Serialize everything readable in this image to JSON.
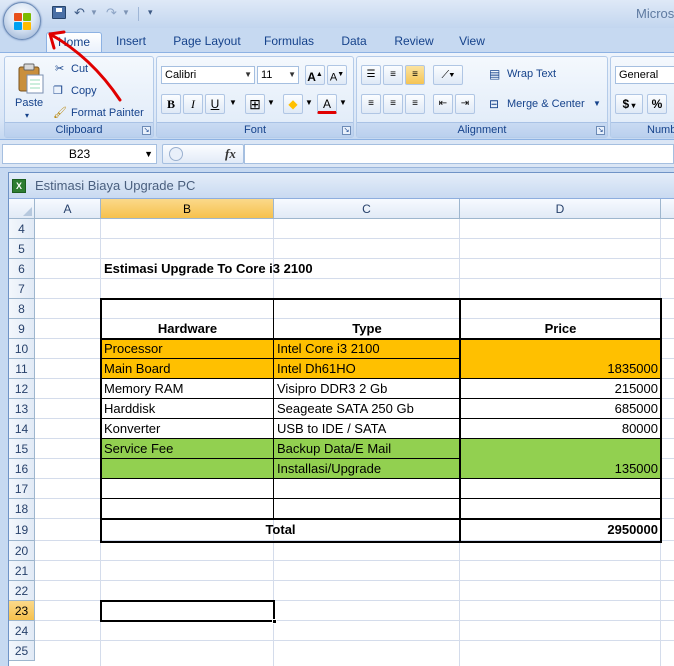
{
  "app": {
    "title": "Micros"
  },
  "tabs": [
    {
      "label": "Home",
      "active": true
    },
    {
      "label": "Insert"
    },
    {
      "label": "Page Layout"
    },
    {
      "label": "Formulas"
    },
    {
      "label": "Data"
    },
    {
      "label": "Review"
    },
    {
      "label": "View"
    }
  ],
  "ribbon": {
    "clipboard": {
      "label": "Clipboard",
      "paste": "Paste",
      "cut": "Cut",
      "copy": "Copy",
      "format_painter": "Format Painter"
    },
    "font": {
      "label": "Font",
      "name": "Calibri",
      "size": "11",
      "grow": "A",
      "shrink": "A",
      "bold": "B",
      "italic": "I",
      "underline": "U",
      "font_color": "A"
    },
    "alignment": {
      "label": "Alignment",
      "wrap_text": "Wrap Text",
      "merge_center": "Merge & Center"
    },
    "number": {
      "label": "Numb",
      "format": "General",
      "currency": "$",
      "percent": "%"
    }
  },
  "formula_bar": {
    "namebox": "B23",
    "fx": "fx",
    "formula": ""
  },
  "workbook": {
    "title": "Estimasi Biaya Upgrade PC",
    "columns": [
      "A",
      "B",
      "C",
      "D"
    ],
    "selected_column": "B",
    "rows": [
      "4",
      "5",
      "6",
      "7",
      "8",
      "9",
      "10",
      "11",
      "12",
      "13",
      "14",
      "15",
      "16",
      "17",
      "18",
      "19",
      "20",
      "21",
      "22",
      "23",
      "24",
      "25"
    ],
    "selected_row": "23",
    "sheet_title": "Estimasi Upgrade To Core i3 2100",
    "table": {
      "headers": [
        "Hardware",
        "Type",
        "Price"
      ],
      "rows": [
        {
          "hardware": "Processor",
          "type": "Intel Core i3 2100",
          "price": ""
        },
        {
          "hardware": "Main Board",
          "type": "Intel Dh61HO",
          "price": "1835000"
        },
        {
          "hardware": "Memory RAM",
          "type": "Visipro DDR3 2 Gb",
          "price": "215000"
        },
        {
          "hardware": "Harddisk",
          "type": "Seageate SATA 250 Gb",
          "price": "685000"
        },
        {
          "hardware": "Konverter",
          "type": "USB to IDE / SATA",
          "price": "80000"
        },
        {
          "hardware": "Service Fee",
          "type": "Backup Data/E Mail",
          "price": ""
        },
        {
          "hardware": "",
          "type": "Installasi/Upgrade",
          "price": "135000"
        }
      ],
      "total_label": "Total",
      "total_value": "2950000"
    },
    "colors": {
      "orange_fill": "#ffc000",
      "green_fill": "#92d050",
      "selection_header": "#f6c14d"
    }
  }
}
